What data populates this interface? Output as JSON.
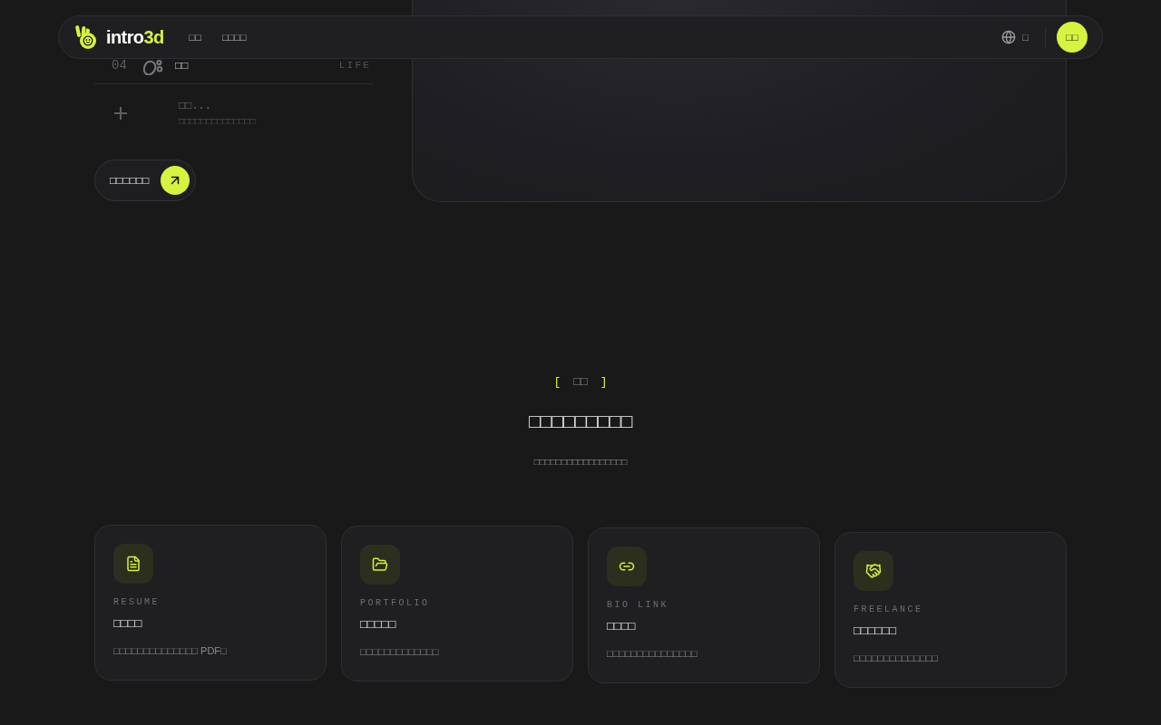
{
  "nav": {
    "brand": {
      "name": "intro",
      "accent": "3d"
    },
    "links": [
      {
        "label": "□□"
      },
      {
        "label": "□□□□"
      }
    ],
    "language": "□",
    "cta": "□□"
  },
  "list": {
    "items": [
      {
        "number": "04",
        "label": "□□",
        "tag": "LIFE"
      }
    ],
    "add_item": {
      "title": "□□...",
      "hint": "□□□□□□□□□□□□□□"
    },
    "button": "□□□□□□"
  },
  "section": {
    "eyebrow": {
      "open": "[",
      "label": "□□",
      "close": "]"
    },
    "title": "□□□□□□□□□",
    "subtitle": "□□□□□□□□□□□□□□□□□",
    "cards": [
      {
        "label": "RESUME",
        "title": "□□□□",
        "description": "□□□□□□□□□□□□□□ PDF□"
      },
      {
        "label": "PORTFOLIO",
        "title": "□□□□□",
        "description": "□□□□□□□□□□□□□"
      },
      {
        "label": "BIO LINK",
        "title": "□□□□",
        "description": "□□□□□□□□□□□□□□□"
      },
      {
        "label": "FREELANCE",
        "title": "□□□□□□",
        "description": "□□□□□□□□□□□□□□"
      }
    ]
  }
}
